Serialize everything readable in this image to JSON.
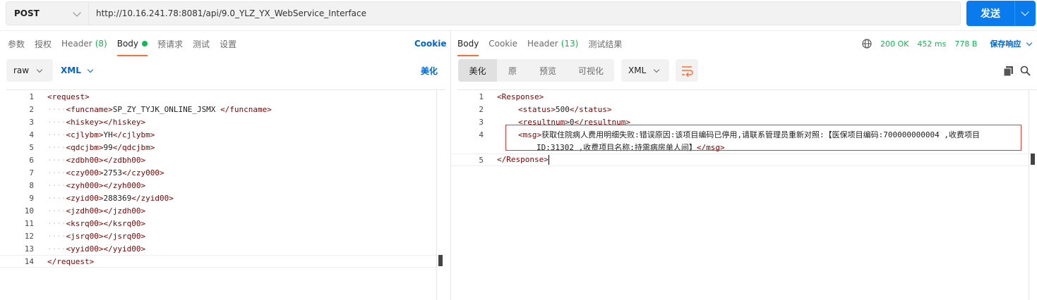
{
  "request": {
    "method": "POST",
    "url": "http://10.16.241.78:8081/api/9.0_YLZ_YX_WebService_Interface",
    "send_label": "发送"
  },
  "req_tabs": {
    "params": "参数",
    "auth": "授权",
    "header": "Header",
    "header_count": "(8)",
    "body": "Body",
    "prerequest": "预请求",
    "tests": "测试",
    "settings": "设置",
    "cookie": "Cookie"
  },
  "req_body": {
    "mode": "raw",
    "format": "XML",
    "beautify": "美化",
    "lines": [
      {
        "n": "1",
        "indent": "",
        "open": "<request>",
        "text": "",
        "close": ""
      },
      {
        "n": "2",
        "indent": "····",
        "open": "<funcname>",
        "text": "SP_ZY_TYJK_ONLINE_JSMX ",
        "close": "</funcname>"
      },
      {
        "n": "3",
        "indent": "····",
        "open": "<hiskey>",
        "text": "",
        "close": "</hiskey>"
      },
      {
        "n": "4",
        "indent": "····",
        "open": "<cjlybm>",
        "text": "YH",
        "close": "</cjlybm>"
      },
      {
        "n": "5",
        "indent": "····",
        "open": "<qdcjbm>",
        "text": "99",
        "close": "</qdcjbm>"
      },
      {
        "n": "6",
        "indent": "····",
        "open": "<zdbh00>",
        "text": "",
        "close": "</zdbh00>"
      },
      {
        "n": "7",
        "indent": "····",
        "open": "<czy000>",
        "text": "2753",
        "close": "</czy000>"
      },
      {
        "n": "8",
        "indent": "····",
        "open": "<zyh000>",
        "text": "",
        "close": "</zyh000>"
      },
      {
        "n": "9",
        "indent": "····",
        "open": "<zyid00>",
        "text": "288369",
        "close": "</zyid00>"
      },
      {
        "n": "10",
        "indent": "····",
        "open": "<jzdh00>",
        "text": "",
        "close": "</jzdh00>"
      },
      {
        "n": "11",
        "indent": "····",
        "open": "<ksrq00>",
        "text": "",
        "close": "</ksrq00>"
      },
      {
        "n": "12",
        "indent": "····",
        "open": "<jsrq00>",
        "text": "",
        "close": "</jsrq00>"
      },
      {
        "n": "13",
        "indent": "····",
        "open": "<yyid00>",
        "text": "",
        "close": "</yyid00>"
      },
      {
        "n": "14",
        "indent": "",
        "open": "</request>",
        "text": "",
        "close": ""
      }
    ]
  },
  "resp_tabs": {
    "body": "Body",
    "cookie": "Cookie",
    "header": "Header",
    "header_count": "(13)",
    "results": "测试结果"
  },
  "resp_status": {
    "code": "200 OK",
    "time": "452 ms",
    "size": "778 B",
    "save": "保存响应"
  },
  "resp_view": {
    "modes": [
      "美化",
      "原",
      "预览",
      "可视化"
    ],
    "active": "美化",
    "format": "XML"
  },
  "resp_body": {
    "l1_n": "1",
    "l1": "<Response>",
    "l2_n": "2",
    "l2_open": "<status>",
    "l2_text": "500",
    "l2_close": "</status>",
    "l3_n": "3",
    "l3_open": "<resultnum>",
    "l3_text": "0",
    "l3_close": "</resultnum>",
    "l4_n": "4",
    "l4_open": "<msg>",
    "l4_text_a": "获取住院病人费用明细失败:错误原因:该项目编码已停用,请联系管理员重新对照:【医保项目编码:700000000004 ,收费项目",
    "l4_text_b": "ID:31302 ,收费项目名称:持需病房单人间】",
    "l4_close": "</msg>",
    "l5_n": "5",
    "l5": "</Response>"
  },
  "colors": {
    "accent": "#ff6c37",
    "send": "#097bed",
    "ok": "#0cbb52",
    "link": "#0265d2",
    "error_box": "#e53935"
  }
}
